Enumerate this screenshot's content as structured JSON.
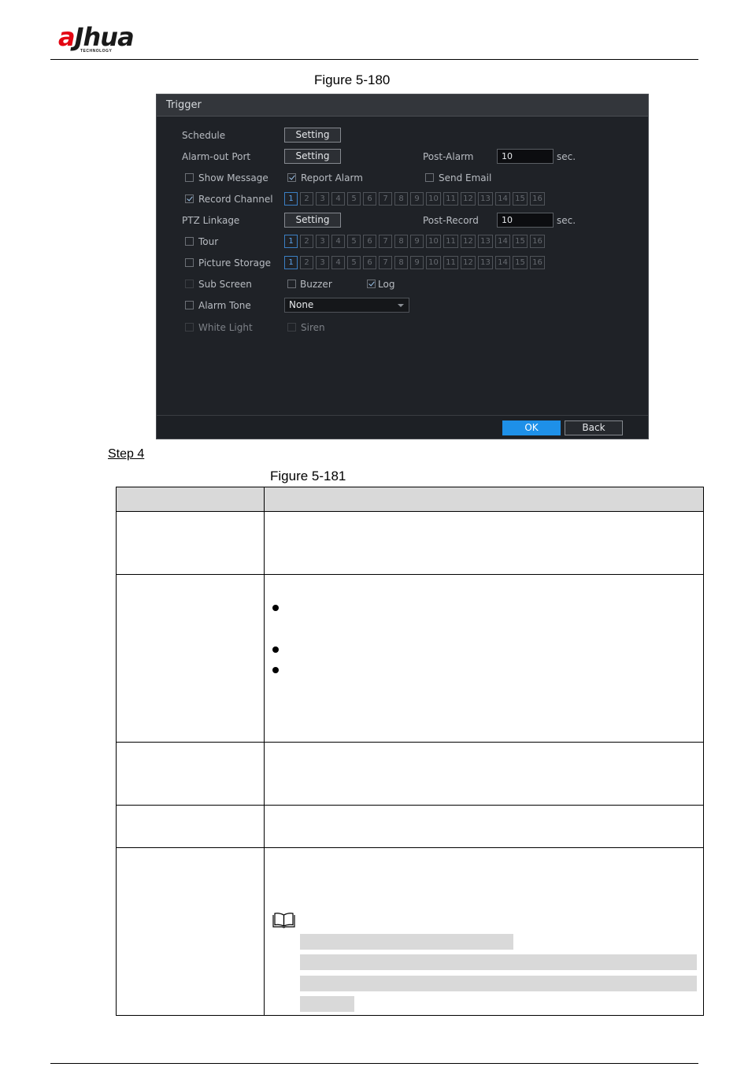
{
  "header": {
    "logo_text_left": "a",
    "logo_text_right": "hua",
    "logo_tagline": "TECHNOLOGY"
  },
  "captions": {
    "figure_top": "Figure 5-180",
    "step": "Step 4",
    "figure_bottom": "Figure 5-181"
  },
  "dialog": {
    "title": "Trigger",
    "schedule_label": "Schedule",
    "setting_label": "Setting",
    "alarm_out_label": "Alarm-out Port",
    "post_alarm_label": "Post-Alarm",
    "post_alarm_value": "10",
    "sec_label": "sec.",
    "show_message_label": "Show Message",
    "report_alarm_label": "Report Alarm",
    "send_email_label": "Send Email",
    "record_channel_label": "Record Channel",
    "ptz_linkage_label": "PTZ Linkage",
    "post_record_label": "Post-Record",
    "post_record_value": "10",
    "tour_label": "Tour",
    "picture_storage_label": "Picture Storage",
    "sub_screen_label": "Sub Screen",
    "buzzer_label": "Buzzer",
    "log_label": "Log",
    "alarm_tone_label": "Alarm Tone",
    "alarm_tone_value": "None",
    "white_light_label": "White Light",
    "siren_label": "Siren",
    "channels": [
      "1",
      "2",
      "3",
      "4",
      "5",
      "6",
      "7",
      "8",
      "9",
      "10",
      "11",
      "12",
      "13",
      "14",
      "15",
      "16"
    ],
    "ok_label": "OK",
    "back_label": "Back",
    "checks": {
      "show_message": false,
      "report_alarm": true,
      "send_email": false,
      "record_channel": true,
      "tour": false,
      "picture_storage": false,
      "sub_screen": false,
      "buzzer": false,
      "log": true,
      "alarm_tone": false,
      "white_light": false,
      "siren": false
    }
  },
  "colors": {
    "brand_red": "#e30613",
    "dialog_bg": "#1f2227",
    "accent_blue": "#1e90e8",
    "table_header": "#d9d9d9"
  }
}
